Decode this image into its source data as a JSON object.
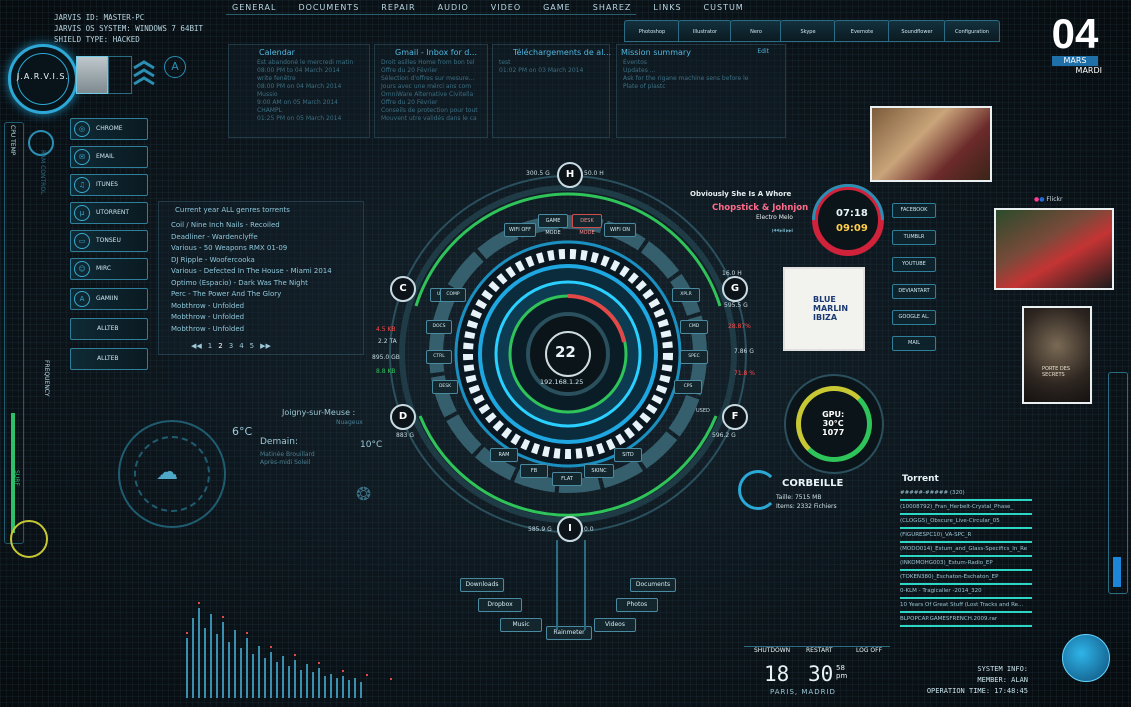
{
  "nav": [
    "GENERAL",
    "DOCUMENTS",
    "REPAIR",
    "AUDIO",
    "VIDEO",
    "GAME",
    "SHAREZ",
    "LINKS",
    "CUSTUM"
  ],
  "system": {
    "id_line": "JARVIS ID: MASTER-PC",
    "os_line": "JARVIS OS SYSTEM: WINDOWS 7 64BIT",
    "shield_line": "SHIELD TYPE: HACKED",
    "logo": "J.A.R.V.I.S."
  },
  "app_tabs": [
    "Photoshop",
    "Illustrator",
    "Nero",
    "Skype",
    "Evernote",
    "Soundflower",
    "Configuration"
  ],
  "date": {
    "day": "04",
    "month": "MARS",
    "weekday": "MARDI"
  },
  "calendar": {
    "title": "Calendar",
    "lines": [
      "Est abandoné le mercredi matin",
      "08:00 PM to 04 March 2014",
      "write fenêtre",
      "08:00 PM on 04 March 2014",
      "Mussio",
      "9:00 AM on 05 March 2014",
      "CHAMPL",
      "01:25 PM on 05 March 2014"
    ]
  },
  "gmail": {
    "title": "Gmail - Inbox for d...",
    "lines": [
      "Droit asilles Home from bon tel",
      "Offre du 20 Février",
      "Sélection d'offres sur mesure...",
      "Jours avec une mérci ans com",
      "OmniWare Alternative Civitella",
      "Offre du 20 Février",
      "Conseils de protection pour tout",
      "Mouvent utre validés dans le ca"
    ]
  },
  "downloads": {
    "title": "Téléchargements de al...",
    "lines": [
      "test",
      "01:02 PM on 03 March 2014"
    ]
  },
  "mission": {
    "title": "Mission summary",
    "edit": "Edit",
    "lines": [
      "Eventos",
      "Updates ...",
      "Ask for the rigane machine sens before le",
      "Plate of plastc"
    ]
  },
  "left_nav": [
    "CHROME",
    "EMAIL",
    "ITUNES",
    "UTORRENT",
    "TONSEU",
    "MIRC",
    "GAMIIN",
    "ALLTEB",
    "ALLTEB"
  ],
  "gauges": {
    "cpu_temp": "CPU TEMP",
    "frequency": "FREQUENCY",
    "surf": "SURF",
    "ram": "RAM CONTROL"
  },
  "torrents": {
    "title": "Current year ALL genres torrents",
    "items": [
      "Coil / Nine Inch Nails - Recoiled",
      "Deadliner - Wardenclyffe",
      "Various - 50 Weapons RMX 01-09",
      "DJ Ripple - Woofercooka",
      "Various - Defected In The House - Miami 2014",
      "Optimo (Espacio) - Dark Was The Night",
      "Perc - The Power And The Glory",
      "Mobthrow - Unfolded",
      "Mobthrow - Unfolded",
      "Mobthrow - Unfolded"
    ],
    "pages": [
      "1",
      "2",
      "3",
      "4",
      "5"
    ]
  },
  "weather": {
    "city": "Joigny-sur-Meuse :",
    "condition": "Nuageux",
    "temp_now": "6°C",
    "tomorrow_label": "Demain:",
    "tomorrow_temp": "10°C",
    "tomorrow_desc": "Matinée Brouillard\nAprès-midi Soleil"
  },
  "hud": {
    "center_value": "22",
    "ip": "192.168.1.25",
    "drives": [
      {
        "letter": "H",
        "a": "300.5 G",
        "b": "50.0 H"
      },
      {
        "letter": "C",
        "a": "4.5 KB",
        "b": "2.2 TA"
      },
      {
        "letter": "G",
        "a": "16.0 H",
        "b": "595.5 G"
      },
      {
        "letter": "D",
        "a": "895.0 GB",
        "b": "8.8 KB"
      },
      {
        "letter": "F",
        "a": "596.2 G",
        "b": "USED"
      },
      {
        "letter": "I",
        "a": "585.9 G",
        "b": "0.0"
      }
    ],
    "inner_labels": [
      "GAME MODE",
      "DESK MODE",
      "WIFI OFF",
      "WIFI ON",
      "UP",
      "COMP",
      "DOCS",
      "CTRL",
      "DESK",
      "ON",
      "XPLR",
      "CMD",
      "SPEC",
      "CPS",
      "USED",
      "RAM",
      "FB",
      "FLAT",
      "SKINC",
      "SITD"
    ],
    "misc_values": [
      "28.87%",
      "7.86 G",
      "71.8 %",
      "868.0 G",
      "883 G"
    ]
  },
  "music": {
    "song": "Obviously She Is A Whore",
    "artist": "Chopstick & Johnjon",
    "album": "Electro Melo",
    "time1": "07:18",
    "time2": "09:09",
    "cover_line1": "BLUE",
    "cover_line2": "MARLIN",
    "cover_line3": "IBIZA"
  },
  "social": [
    "FACEBOOK",
    "TUMBLR",
    "YOUTUBE",
    "DEVIANTART",
    "GOOGLE AL.",
    "MAIL"
  ],
  "gpu": {
    "label": "GPU:",
    "temp": "30°C",
    "value": "1077"
  },
  "trash": {
    "title": "CORBEILLE",
    "size_label": "Taille:",
    "size": "7515 MB",
    "items_label": "Items:",
    "items": "2332 Fichiers"
  },
  "flickr": "Flickr",
  "poster_text": "PORTE DES SECRETS",
  "right_torrent": {
    "title": "Torrent",
    "items": [
      "#####-##### (320)",
      "(10008792)_Fran_Herbelt-Crystal_Phase_",
      "(CLOGG5)_Obscure_Live-Circular_05",
      "(FIGURESPC10)_VA-SPC_R",
      "(MODO014)_Estum_and_Glass-Specifics_In_Re",
      "(INKOMOHG003)_Estum-Radio_EP",
      "(TOKEN380)_Eschaton-Eschaton_EP",
      "0-KLM - Tragicaller -2014_320",
      "10 Years Of Great Stuff (Lost Tracks and Re...",
      "BLPOPCAP.GAMESFRENCH.2009.rar"
    ]
  },
  "folders": [
    "Downloads",
    "Documents",
    "Dropbox",
    "Photos",
    "Music",
    "Videos",
    "Rainmeter"
  ],
  "power": [
    "SHUTDOWN",
    "RESTART",
    "LOG OFF"
  ],
  "clock": {
    "hour": "18",
    "minute": "30",
    "seconds": "58",
    "ampm": "pm",
    "cities": "PARIS, MADRID"
  },
  "system_info": {
    "title": "SYSTEM INFO:",
    "member": "MEMBER: ALAN",
    "uptime": "OPERATION TIME: 17:48:45"
  }
}
